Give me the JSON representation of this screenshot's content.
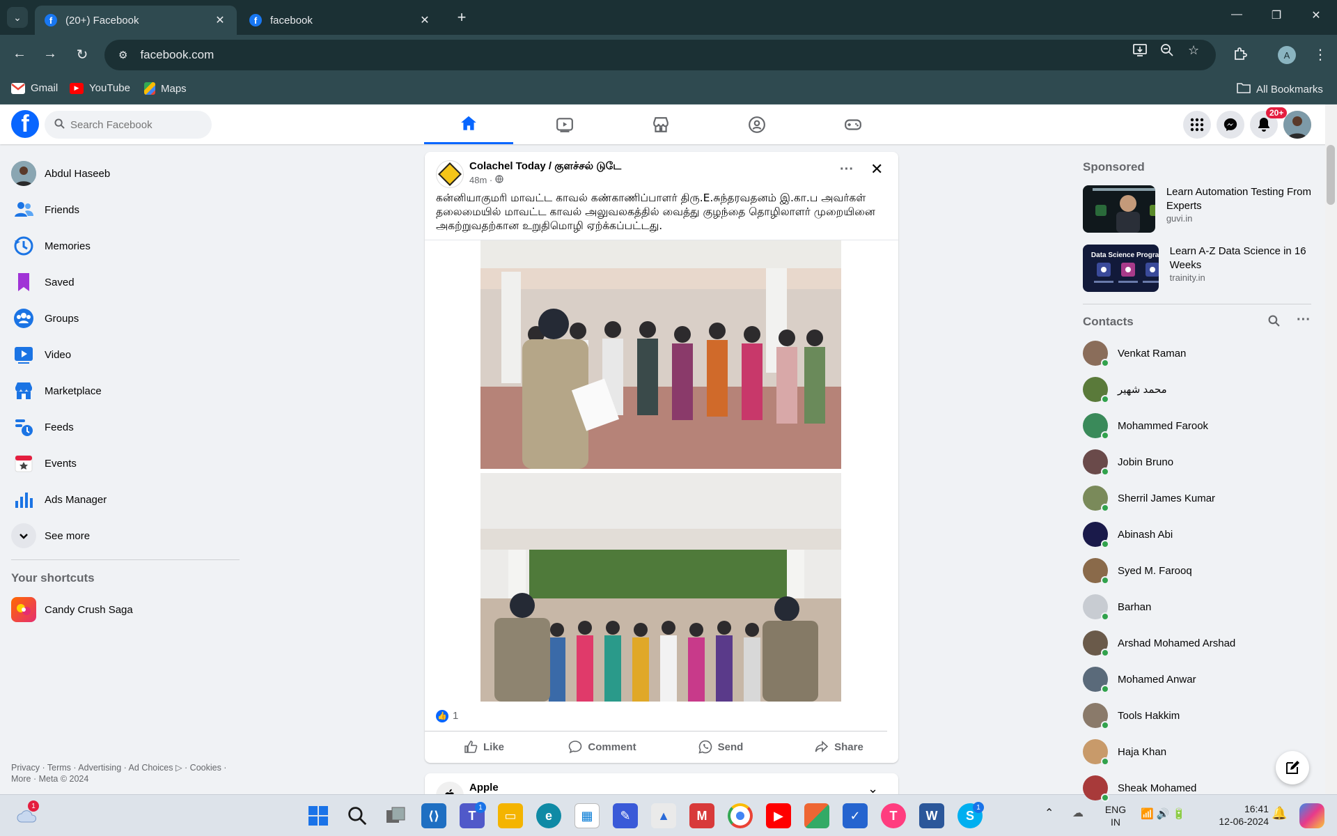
{
  "browser": {
    "tabs": [
      {
        "title": "(20+) Facebook",
        "active": true
      },
      {
        "title": "facebook",
        "active": false
      }
    ],
    "url": "facebook.com",
    "bookmarks": [
      {
        "label": "Gmail",
        "color": "#ea4335"
      },
      {
        "label": "YouTube",
        "color": "#ff0000"
      },
      {
        "label": "Maps",
        "color": "#34a853"
      }
    ],
    "all_bookmarks": "All Bookmarks",
    "profile_initial": "A"
  },
  "fb": {
    "logo": "f",
    "search_placeholder": "Search Facebook",
    "notifications_badge": "20+",
    "accent": "#0866ff"
  },
  "left_nav": {
    "items": [
      {
        "label": "Abdul Haseeb",
        "icon": "profile-avatar"
      },
      {
        "label": "Friends",
        "icon": "friends-icon"
      },
      {
        "label": "Memories",
        "icon": "memories-icon"
      },
      {
        "label": "Saved",
        "icon": "saved-icon"
      },
      {
        "label": "Groups",
        "icon": "groups-icon"
      },
      {
        "label": "Video",
        "icon": "video-icon"
      },
      {
        "label": "Marketplace",
        "icon": "marketplace-icon"
      },
      {
        "label": "Feeds",
        "icon": "feeds-icon"
      },
      {
        "label": "Events",
        "icon": "events-icon"
      },
      {
        "label": "Ads Manager",
        "icon": "ads-manager-icon"
      },
      {
        "label": "See more",
        "icon": "chevron-down-icon"
      }
    ],
    "shortcuts_title": "Your shortcuts",
    "shortcuts": [
      {
        "label": "Candy Crush Saga"
      }
    ],
    "footer": "Privacy · Terms · Advertising · Ad Choices ▷ · Cookies · More · Meta © 2024"
  },
  "post": {
    "page_name": "Colachel Today  / குளச்சல் டுடே",
    "time": "48m",
    "text": "கன்னியாகுமரி மாவட்ட காவல் கண்காணிப்பாளர் திரு.E.சுந்தரவதனம் இ.கா.ப அவர்கள் தலைமையில் மாவட்ட காவல் அலுவலகத்தில் வைத்து குழந்தை தொழிலாளர் முறையினை அகற்றுவதற்கான உறுதிமொழி ஏற்க்கப்பட்டது.",
    "reaction_count": "1",
    "actions": [
      "Like",
      "Comment",
      "Send",
      "Share"
    ]
  },
  "next_post": {
    "page_name": "Apple"
  },
  "right_col": {
    "sponsored_title": "Sponsored",
    "ads": [
      {
        "title": "Learn Automation Testing From Experts",
        "domain": "guvi.in"
      },
      {
        "title": "Learn A-Z Data Science in 16 Weeks",
        "domain": "trainity.in",
        "image_caption": "Data Science Program"
      }
    ],
    "contacts_title": "Contacts",
    "contacts": [
      {
        "name": "Venkat Raman",
        "color": "#8a6d5a"
      },
      {
        "name": "محمد شهير",
        "color": "#5a7a3a"
      },
      {
        "name": "Mohammed Farook",
        "color": "#3a8a5a"
      },
      {
        "name": "Jobin Bruno",
        "color": "#6a4a4a"
      },
      {
        "name": "Sherril James Kumar",
        "color": "#7a8a5a"
      },
      {
        "name": "Abinash Abi",
        "color": "#1a1a4a"
      },
      {
        "name": "Syed M. Farooq",
        "color": "#8a6a4a"
      },
      {
        "name": "Barhan",
        "color": "#c8ccd2"
      },
      {
        "name": "Arshad Mohamed Arshad",
        "color": "#6a5a4a"
      },
      {
        "name": "Mohamed Anwar",
        "color": "#5a6a7a"
      },
      {
        "name": "Tools Hakkim",
        "color": "#8a7a6a"
      },
      {
        "name": "Haja Khan",
        "color": "#c89a6a"
      },
      {
        "name": "Sheak Mohamed",
        "color": "#a83a3a"
      }
    ]
  },
  "taskbar": {
    "weather_badge": "1",
    "teams_badge": "1",
    "skype_badge": "1",
    "lang_line1": "ENG",
    "lang_line2": "IN",
    "time": "16:41",
    "date": "12-06-2024"
  }
}
